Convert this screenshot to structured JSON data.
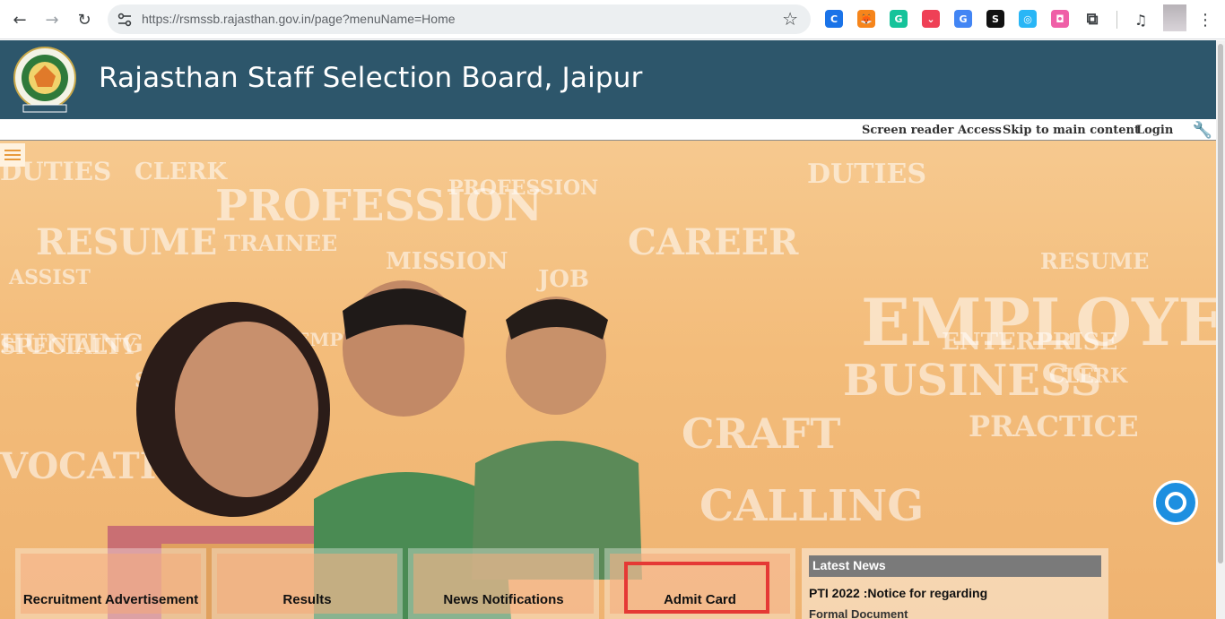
{
  "browser": {
    "url": "https://rsmssb.rajasthan.gov.in/page?menuName=Home",
    "extensions": [
      {
        "name": "copyright-extension-icon",
        "glyph": "C",
        "color": "#1a73e8"
      },
      {
        "name": "metamask-icon",
        "glyph": "🦊",
        "color": "#f6851b"
      },
      {
        "name": "grammarly-icon",
        "glyph": "G",
        "color": "#15c39a"
      },
      {
        "name": "pocket-icon",
        "glyph": "⌄",
        "color": "#ef4056"
      },
      {
        "name": "google-translate-icon",
        "glyph": "G",
        "color": "#4285f4"
      },
      {
        "name": "s-extension-icon",
        "glyph": "S",
        "color": "#111111"
      },
      {
        "name": "circle-extension-icon",
        "glyph": "◎",
        "color": "#29b6f6"
      },
      {
        "name": "camera-extension-icon",
        "glyph": "◘",
        "color": "#ef5fa7"
      },
      {
        "name": "puzzle-extensions-icon",
        "glyph": "⧉",
        "color": "#3c4043"
      }
    ]
  },
  "site": {
    "title": "Rajasthan Staff Selection Board, Jaipur",
    "header_color": "#2d566b"
  },
  "util_links": {
    "screen_reader": "Screen reader Access",
    "skip": "Skip to main content",
    "login": "Login"
  },
  "hero_words": [
    "DUTIES",
    "CLERK",
    "PROFESSION",
    "RESUME",
    "TRAINEE",
    "MISSION",
    "ASSIST",
    "JOB",
    "HUNTING",
    "SEARCH",
    "EMPLOYERS",
    "BUSINESS",
    "SPECIALTY",
    "EMPLOYMENT",
    "CAREER",
    "CRAFT",
    "PRACTICE",
    "VOCATION",
    "CALLING",
    "ENTERPRISE"
  ],
  "tiles": {
    "recruitment": "Recruitment Advertisement",
    "results": "Results",
    "news_notifications": "News Notifications",
    "admit_card": "Admit Card"
  },
  "news": {
    "heading": "Latest News",
    "item1": "PTI 2022 :Notice for regarding",
    "item2": "Formal Document"
  },
  "colors": {
    "highlight": "#e53935",
    "accessibility": "#1d8fe0"
  }
}
